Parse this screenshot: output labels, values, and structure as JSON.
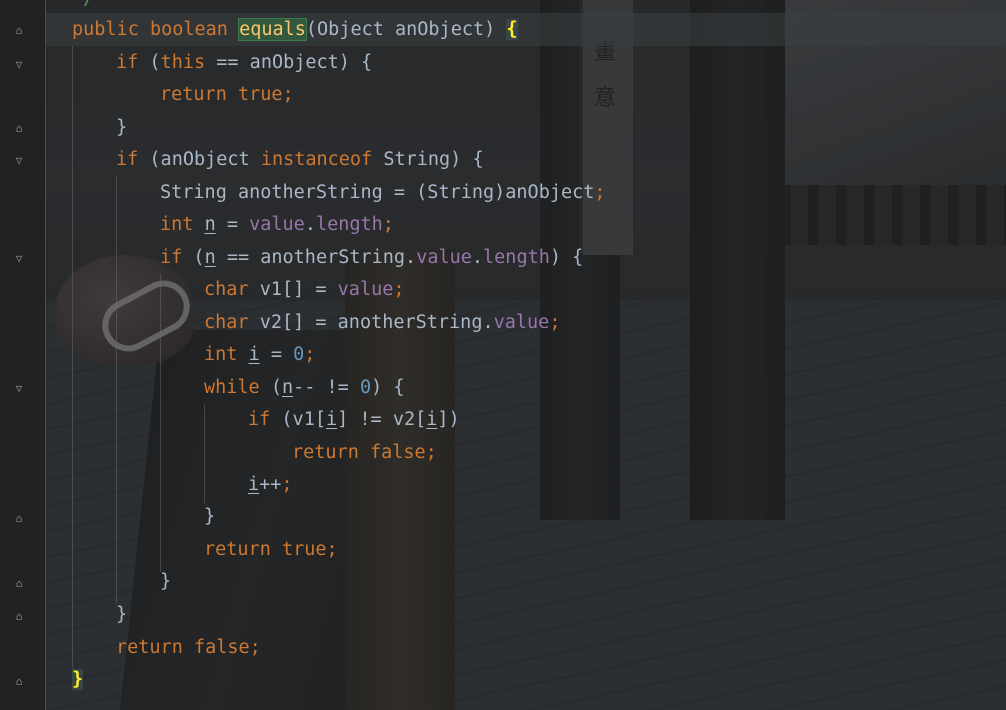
{
  "editor": {
    "comment_tail": "*/",
    "method_header": {
      "modifiers": "public boolean ",
      "name": "equals",
      "params": "(Object anObject) ",
      "open_brace": "{"
    },
    "lines": {
      "l2": {
        "if": "if",
        "pre": " (",
        "this": "this",
        "rest": " == anObject) {"
      },
      "l3": {
        "return": "return ",
        "val": "true",
        "semi": ";"
      },
      "l4": {
        "text": "}"
      },
      "l5": {
        "if": "if",
        "pre": " (anObject ",
        "instanceof": "instanceof",
        "rest": " String) {"
      },
      "l6": {
        "text": "String anotherString = (String)anObject",
        "semi": ";"
      },
      "l7": {
        "type": "int",
        "sp": " ",
        "var": "n",
        "eq": " = ",
        "field": "value",
        "dot": ".",
        "len": "length",
        "semi": ";"
      },
      "l8": {
        "if": "if",
        "pre": " (",
        "var": "n",
        "mid": " == anotherString.",
        "field": "value",
        "dot": ".",
        "len": "length",
        "rest": ") {"
      },
      "l9": {
        "type": "char",
        "rest": " v1[] = ",
        "field": "value",
        "semi": ";"
      },
      "l10": {
        "type": "char",
        "rest": " v2[] = anotherString.",
        "field": "value",
        "semi": ";"
      },
      "l11": {
        "type": "int",
        "sp": " ",
        "var": "i",
        "eq": " = ",
        "num": "0",
        "semi": ";"
      },
      "l12": {
        "while": "while",
        "pre": " (",
        "var": "n",
        "mid": "-- != ",
        "num": "0",
        "rest": ") {"
      },
      "l13": {
        "if": "if",
        "pre": " (v1[",
        "var1": "i",
        "mid": "] != v2[",
        "var2": "i",
        "rest": "])"
      },
      "l14": {
        "return": "return ",
        "val": "false",
        "semi": ";"
      },
      "l15": {
        "var": "i",
        "op": "++",
        "semi": ";"
      },
      "l16": {
        "text": "}"
      },
      "l17": {
        "return": "return ",
        "val": "true",
        "semi": ";"
      },
      "l18": {
        "text": "}"
      },
      "l19": {
        "text": "}"
      },
      "l20": {
        "return": "return ",
        "val": "false",
        "semi": ";"
      },
      "l21": {
        "text": "}"
      }
    },
    "background_sign": [
      "畫",
      "意"
    ],
    "colors": {
      "keyword": "#cc7832",
      "field": "#9876aa",
      "number": "#6897bb",
      "plain": "#a9b7c6",
      "method_decl": "#ffc66d",
      "brace_match": "#ffef28",
      "method_highlight_bg": "#32593d"
    }
  }
}
